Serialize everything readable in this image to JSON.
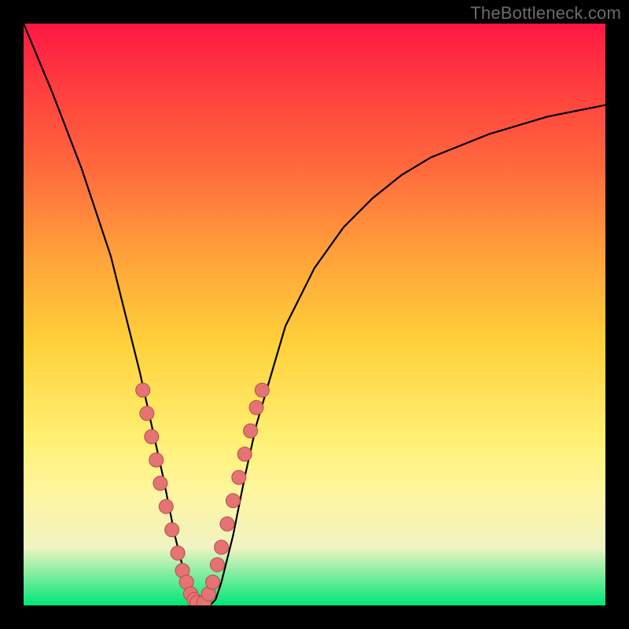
{
  "watermark": "TheBottleneck.com",
  "chart_data": {
    "type": "line",
    "title": "",
    "xlabel": "",
    "ylabel": "",
    "xlim": [
      0,
      100
    ],
    "ylim": [
      0,
      100
    ],
    "x": [
      0,
      5,
      10,
      15,
      18,
      20,
      22,
      24,
      26,
      28,
      29,
      30,
      31,
      32,
      33,
      34,
      36,
      38,
      40,
      45,
      50,
      55,
      60,
      65,
      70,
      75,
      80,
      85,
      90,
      95,
      100
    ],
    "y": [
      100,
      88,
      75,
      60,
      48,
      40,
      31,
      22,
      12,
      4,
      1,
      0,
      0,
      0,
      1,
      4,
      12,
      22,
      31,
      48,
      58,
      65,
      70,
      74,
      77,
      79,
      81,
      82.5,
      84,
      85,
      86
    ],
    "markers_left": {
      "x": [
        20.5,
        21.2,
        22.0,
        22.8,
        23.5,
        24.5,
        25.5,
        26.5,
        27.3,
        28.0,
        28.7,
        29.3,
        29.8
      ],
      "y": [
        37,
        33,
        29,
        25,
        21,
        17,
        13,
        9,
        6,
        4,
        2,
        1,
        0.5
      ]
    },
    "markers_right": {
      "x": [
        31.0,
        31.8,
        32.5,
        33.3,
        34.0,
        35.0,
        36.0,
        37.0,
        38.0,
        39.0,
        40.0,
        41.0
      ],
      "y": [
        0.5,
        2,
        4,
        7,
        10,
        14,
        18,
        22,
        26,
        30,
        34,
        37
      ]
    },
    "marker_color": "#e57373",
    "marker_stroke": "#b84d4d",
    "curve_color": "#000000"
  }
}
